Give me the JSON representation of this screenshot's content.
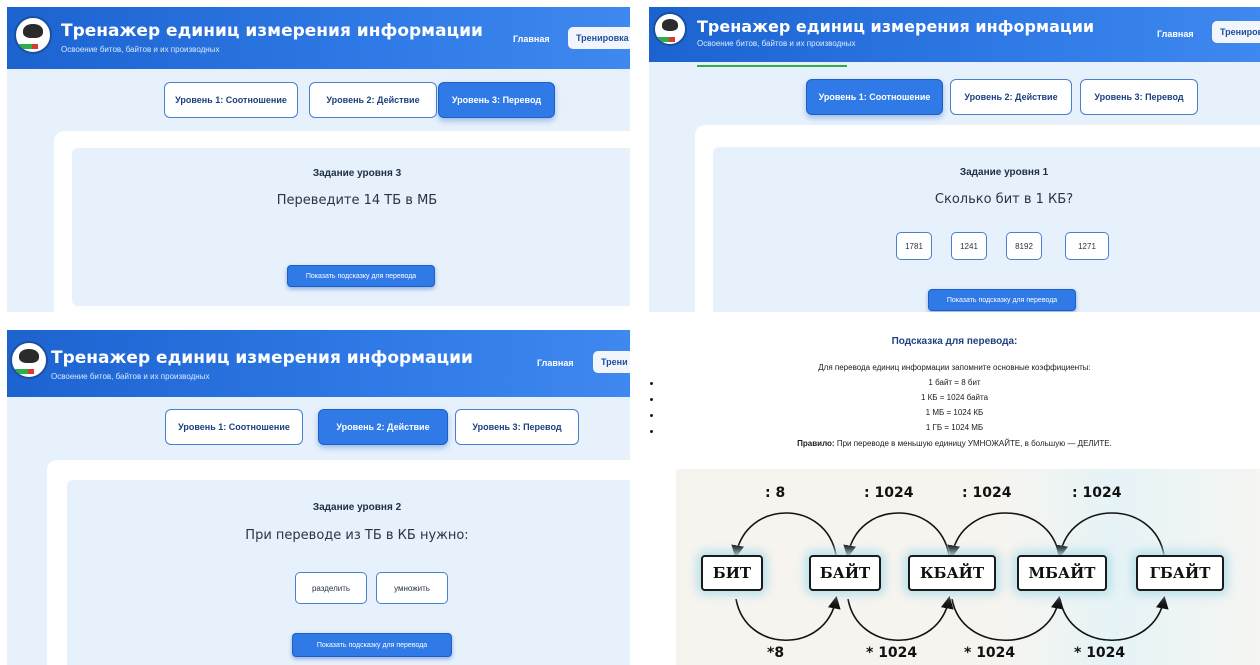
{
  "header": {
    "title": "Тренажер единиц измерения информации",
    "subtitle": "Освоение битов, байтов и их производных",
    "nav_home": "Главная",
    "nav_training": "Тренировка",
    "nav_training_cut_p2": "Тренировк",
    "nav_training_cut_p3": "Трени"
  },
  "levels": {
    "level1": "Уровень 1: Соотношение",
    "level2": "Уровень 2: Действие",
    "level3": "Уровень 3: Перевод"
  },
  "panel1": {
    "active_level": 3,
    "task_title": "Задание уровня 3",
    "question": "Переведите 14 ТБ в МБ",
    "hint_button": "Показать подсказку для перевода"
  },
  "panel2": {
    "active_level": 1,
    "task_title": "Задание уровня 1",
    "question": "Сколько бит в 1 КБ?",
    "options": [
      "1781",
      "1241",
      "8192",
      "1271"
    ],
    "hint_button": "Показать подсказку для перевода"
  },
  "panel3": {
    "active_level": 2,
    "task_title": "Задание уровня 2",
    "question": "При переводе из ТБ в КБ нужно:",
    "options": [
      "разделить",
      "умножить"
    ],
    "hint_button": "Показать подсказку для перевода"
  },
  "panel4": {
    "hint_title": "Подсказка для перевода:",
    "intro": "Для перевода единиц информации запомните основные коэффициенты:",
    "facts": [
      "1 байт = 8 бит",
      "1 КБ = 1024 байта",
      "1 МБ = 1024 КБ",
      "1 ГБ = 1024 МБ"
    ],
    "rule_label": "Правило:",
    "rule_text": " При переводе в меньшую единицу УМНОЖАЙТЕ, в большую — ДЕЛИТЕ.",
    "diagram": {
      "units": [
        "БИТ",
        "БАЙТ",
        "КБАЙТ",
        "МБАЙТ",
        "ГБАЙТ"
      ],
      "divide_labels": [
        ": 8",
        ": 1024",
        ": 1024",
        ": 1024"
      ],
      "multiply_labels": [
        "*8",
        "* 1024",
        "* 1024",
        "* 1024"
      ]
    }
  },
  "colors": {
    "header_blue": "#2f7ae6",
    "active_button": "#2f7ae6",
    "task_background": "#e6f1fc",
    "accent_green": "#2fae48"
  }
}
